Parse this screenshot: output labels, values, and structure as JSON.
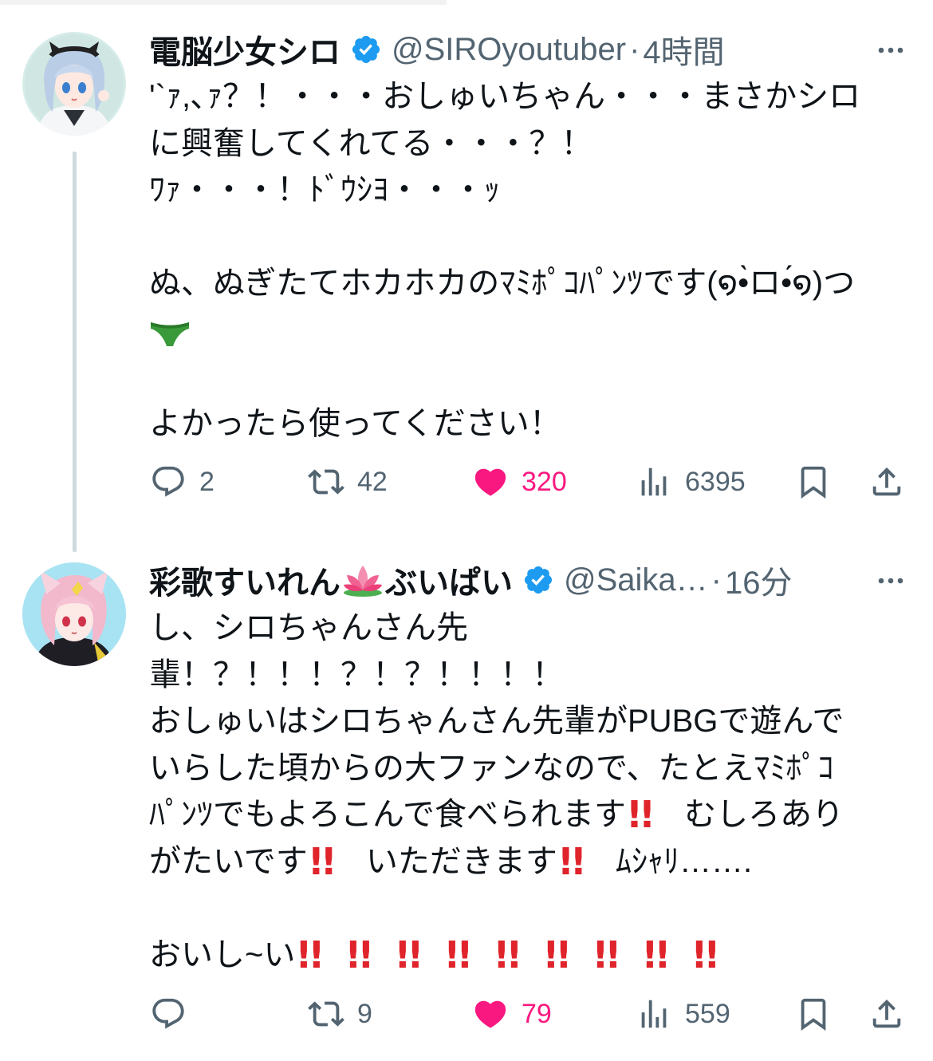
{
  "tweets": [
    {
      "name": "電脳少女シロ",
      "handle": "@SIROyoutuber",
      "sep": "·",
      "time": "4時間",
      "lines": [
        "'`ｧ,､ｧ？！・・・おしゅいちゃん・・・まさかシロ",
        "に興奮してくれてる・・・？！",
        "ﾜｧ・・・！ﾄﾞｳｼﾖ・・・ｯ",
        "",
        "ぬ、ぬぎたてホカホカのﾏﾐﾎﾟｺﾊﾟﾝﾂです(໑•̀ロ•́໑)つ",
        "🩲",
        "",
        "よかったら使ってください！"
      ],
      "stats": {
        "replies": "2",
        "retweets": "42",
        "likes": "320",
        "views": "6395"
      }
    },
    {
      "name": "彩歌すいれん",
      "name_emoji": "lotus-icon",
      "name_suffix": "ぶいぱい",
      "handle": "@Saika…",
      "sep": "·",
      "time": "16分",
      "lines": [
        "し、シロちゃんさん先",
        "輩！？！！！？！？！！！！",
        "おしゅいはシロちゃんさん先輩がPUBGで遊んで",
        "いらした頃からの大ファンなので、たとえﾏﾐﾎﾟｺ",
        "ﾊﾟﾝﾂでもよろこんで食べられます‼️ むしろあり",
        "がたいです‼️ いただきます‼️ ﾑｼｬﾘ…….",
        "",
        "おいし~い‼️‼️‼️‼️‼️‼️‼️‼️‼️"
      ],
      "stats": {
        "replies": "",
        "retweets": "9",
        "likes": "79",
        "views": "559"
      }
    }
  ],
  "colors": {
    "verified": "#1d9bf0",
    "like": "#f91880",
    "muted": "#536471",
    "exclamation": "#e0242b",
    "briefs": "#3a9a3a"
  }
}
